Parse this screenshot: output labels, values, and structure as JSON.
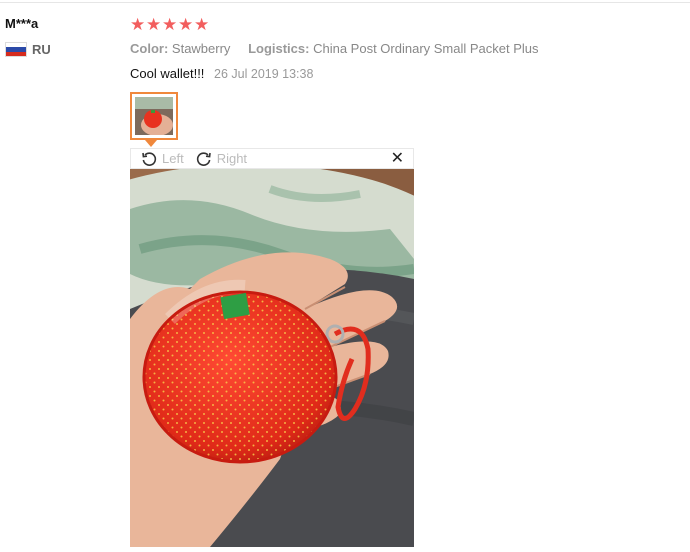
{
  "review": {
    "user_name": "M***a",
    "country_code": "RU",
    "flag_colors": [
      "#ffffff",
      "#2b4aa8",
      "#d52b1e"
    ],
    "rating": 5,
    "star_color": "#f25e5e",
    "color_label": "Color:",
    "color_value": "Stawberry",
    "logistics_label": "Logistics:",
    "logistics_value": "China Post Ordinary Small Packet Plus",
    "text": "Cool wallet!!!",
    "date": "26 Jul 2019 13:38"
  },
  "viewer": {
    "rotate_left_label": "Left",
    "rotate_right_label": "Right",
    "close_glyph": "✕",
    "accent_color": "#f0883c"
  }
}
